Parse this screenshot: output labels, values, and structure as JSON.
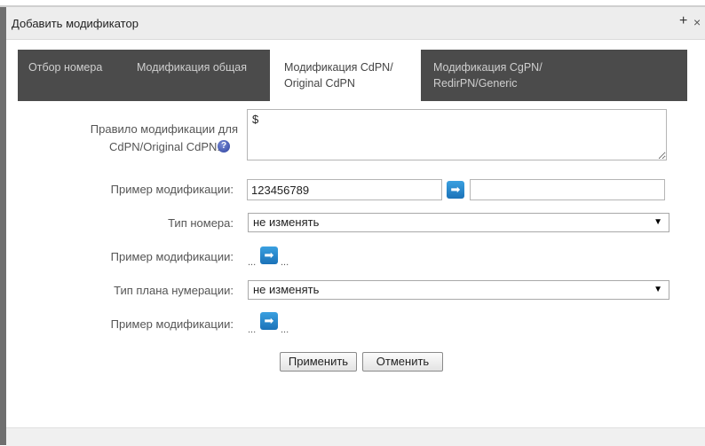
{
  "dialog": {
    "title": "Добавить модификатор",
    "plus_icon": "+",
    "close_icon": "×"
  },
  "tabs": [
    {
      "label": "Отбор номера",
      "active": false
    },
    {
      "label": "Модификация общая",
      "active": false
    },
    {
      "label_line1": "Модификация CdPN/",
      "label_line2": "Original CdPN",
      "active": true
    },
    {
      "label_line1": "Модификация CgPN/",
      "label_line2": "RedirPN/Generic",
      "active": false
    }
  ],
  "form": {
    "rule_label_line1": "Правило модификации для",
    "rule_label_line2": "CdPN/Original CdPN:",
    "help_icon": "?",
    "rule_value": "$",
    "example_label": "Пример модификации:",
    "example_input_value": "123456789",
    "example_output_value": "",
    "arrow_icon": "➡",
    "number_type_label": "Тип номера:",
    "number_type_value": "не изменять",
    "example2_label": "Пример модификации:",
    "ellipsis": "...",
    "numbering_plan_label": "Тип плана нумерации:",
    "numbering_plan_value": "не изменять",
    "example3_label": "Пример модификации:",
    "caret": "▼"
  },
  "buttons": {
    "apply": "Применить",
    "cancel": "Отменить"
  }
}
